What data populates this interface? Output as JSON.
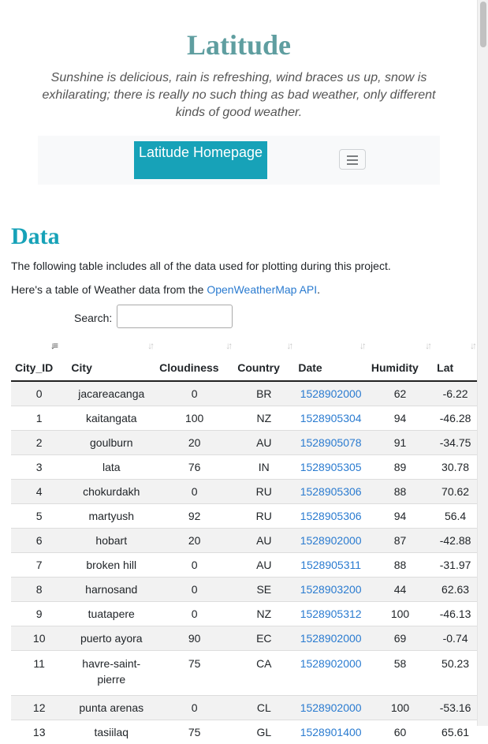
{
  "header": {
    "title": "Latitude",
    "tagline": "Sunshine is delicious, rain is refreshing, wind braces us up, snow is exhilarating; there is really no such thing as bad weather, only different kinds of good weather."
  },
  "navbar": {
    "brand": "Latitude Homepage",
    "toggler_icon": "hamburger-icon"
  },
  "section": {
    "title": "Data",
    "intro": "The following table includes all of the data used for plotting during this project.",
    "source_prefix": "Here's a table of Weather data from the ",
    "source_link": "OpenWeatherMap API",
    "source_suffix": "."
  },
  "search": {
    "label": "Search:",
    "value": ""
  },
  "table": {
    "columns": [
      "City_ID",
      "City",
      "Cloudiness",
      "Country",
      "Date",
      "Humidity",
      "Lat"
    ],
    "sorted_column": "City_ID",
    "rows": [
      [
        "0",
        "jacareacanga",
        "0",
        "BR",
        "1528902000",
        "62",
        "-6.22"
      ],
      [
        "1",
        "kaitangata",
        "100",
        "NZ",
        "1528905304",
        "94",
        "-46.28"
      ],
      [
        "2",
        "goulburn",
        "20",
        "AU",
        "1528905078",
        "91",
        "-34.75"
      ],
      [
        "3",
        "lata",
        "76",
        "IN",
        "1528905305",
        "89",
        "30.78"
      ],
      [
        "4",
        "chokurdakh",
        "0",
        "RU",
        "1528905306",
        "88",
        "70.62"
      ],
      [
        "5",
        "martyush",
        "92",
        "RU",
        "1528905306",
        "94",
        "56.4"
      ],
      [
        "6",
        "hobart",
        "20",
        "AU",
        "1528902000",
        "87",
        "-42.88"
      ],
      [
        "7",
        "broken hill",
        "0",
        "AU",
        "1528905311",
        "88",
        "-31.97"
      ],
      [
        "8",
        "harnosand",
        "0",
        "SE",
        "1528903200",
        "44",
        "62.63"
      ],
      [
        "9",
        "tuatapere",
        "0",
        "NZ",
        "1528905312",
        "100",
        "-46.13"
      ],
      [
        "10",
        "puerto ayora",
        "90",
        "EC",
        "1528902000",
        "69",
        "-0.74"
      ],
      [
        "11",
        "havre-saint-pierre",
        "75",
        "CA",
        "1528902000",
        "58",
        "50.23"
      ],
      [
        "12",
        "punta arenas",
        "0",
        "CL",
        "1528902000",
        "100",
        "-53.16"
      ],
      [
        "13",
        "tasiilaq",
        "75",
        "GL",
        "1528901400",
        "60",
        "65.61"
      ]
    ]
  }
}
